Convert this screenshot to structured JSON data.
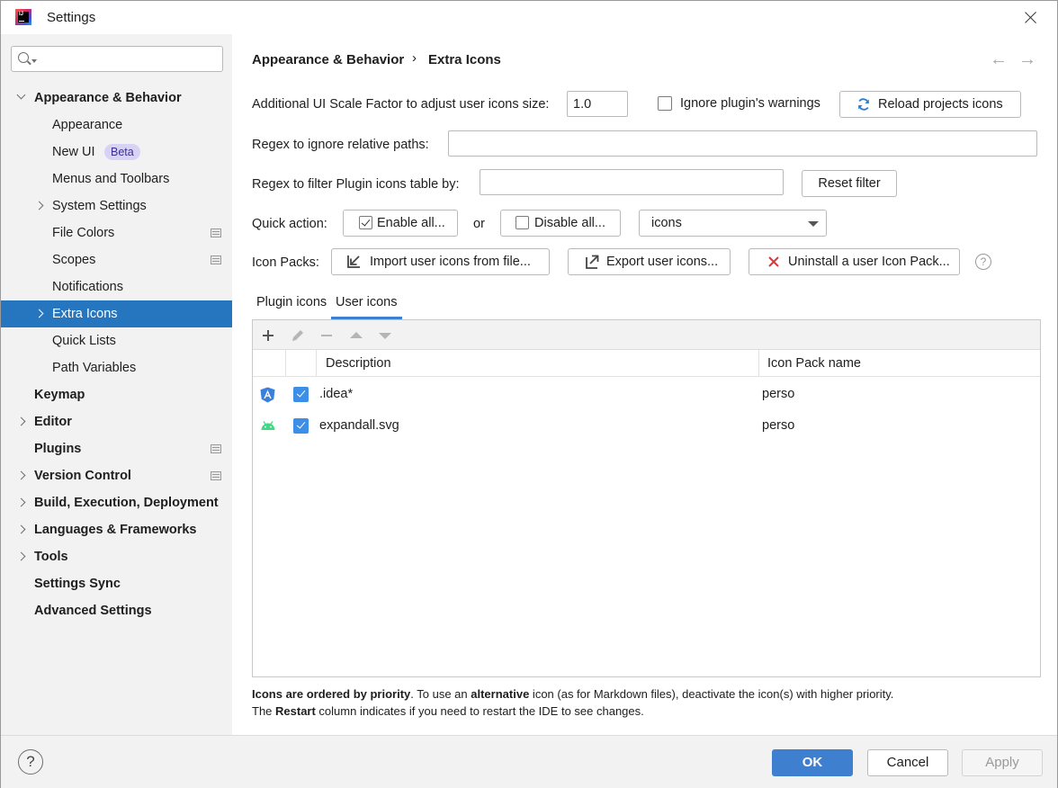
{
  "window": {
    "title": "Settings"
  },
  "sidebar": {
    "search": {
      "value": "",
      "placeholder": ""
    },
    "items": [
      {
        "label": "Appearance & Behavior",
        "bold": true,
        "chevron": "down",
        "indent": 0
      },
      {
        "label": "Appearance",
        "indent": 1
      },
      {
        "label": "New UI",
        "indent": 1,
        "badge": "Beta"
      },
      {
        "label": "Menus and Toolbars",
        "indent": 1
      },
      {
        "label": "System Settings",
        "indent": 1,
        "chevron": "right"
      },
      {
        "label": "File Colors",
        "indent": 1,
        "scope": true
      },
      {
        "label": "Scopes",
        "indent": 1,
        "scope": true
      },
      {
        "label": "Notifications",
        "indent": 1
      },
      {
        "label": "Extra Icons",
        "indent": 1,
        "chevron": "right",
        "selected": true
      },
      {
        "label": "Quick Lists",
        "indent": 1
      },
      {
        "label": "Path Variables",
        "indent": 1
      },
      {
        "label": "Keymap",
        "bold": true,
        "indent": 0
      },
      {
        "label": "Editor",
        "bold": true,
        "chevron": "right",
        "indent": 0
      },
      {
        "label": "Plugins",
        "bold": true,
        "indent": 0,
        "scope": true
      },
      {
        "label": "Version Control",
        "bold": true,
        "chevron": "right",
        "indent": 0,
        "scope": true
      },
      {
        "label": "Build, Execution, Deployment",
        "bold": true,
        "chevron": "right",
        "indent": 0
      },
      {
        "label": "Languages & Frameworks",
        "bold": true,
        "chevron": "right",
        "indent": 0
      },
      {
        "label": "Tools",
        "bold": true,
        "chevron": "right",
        "indent": 0
      },
      {
        "label": "Settings Sync",
        "bold": true,
        "indent": 0
      },
      {
        "label": "Advanced Settings",
        "bold": true,
        "indent": 0
      }
    ]
  },
  "breadcrumb": {
    "parent": "Appearance & Behavior",
    "separator": "›",
    "current": "Extra Icons",
    "back": "←",
    "forward": "→"
  },
  "form": {
    "scale_label": "Additional UI Scale Factor to adjust user icons size:",
    "scale_value": "1.0",
    "ignore_warnings_label": "Ignore plugin's warnings",
    "ignore_warnings_checked": false,
    "reload_label": "Reload projects icons",
    "regex_ignore_label": "Regex to ignore relative paths:",
    "regex_ignore_value": "",
    "regex_filter_label": "Regex to filter Plugin icons table by:",
    "regex_filter_value": "",
    "reset_filter_label": "Reset filter",
    "quick_action_label": "Quick action:",
    "enable_all_label": "Enable all...",
    "or_label": "or",
    "disable_all_label": "Disable all...",
    "quick_action_select": "icons",
    "icon_packs_label": "Icon Packs:",
    "import_label": "Import user icons from file...",
    "export_label": "Export user icons...",
    "uninstall_label": "Uninstall a user Icon Pack...",
    "help": "?"
  },
  "tabs": [
    {
      "label": "Plugin icons",
      "active": false
    },
    {
      "label": "User icons",
      "active": true
    }
  ],
  "table": {
    "columns": [
      "Description",
      "Icon Pack name"
    ],
    "rows": [
      {
        "icon": "angular-icon",
        "checked": true,
        "description": ".idea*",
        "pack": "perso"
      },
      {
        "icon": "android-icon",
        "checked": true,
        "description": "expandall.svg",
        "pack": "perso"
      }
    ]
  },
  "notes": {
    "line1_bold1": "Icons are ordered by priority",
    "line1_text1": ". To use an ",
    "line1_bold2": "alternative",
    "line1_text2": " icon (as for Markdown files), deactivate the icon(s) with higher priority.",
    "line2_text1": "The ",
    "line2_bold": "Restart",
    "line2_text2": " column indicates if you need to restart the IDE to see changes."
  },
  "footer": {
    "help": "?",
    "ok": "OK",
    "cancel": "Cancel",
    "apply": "Apply"
  },
  "colors": {
    "accent": "#3e7fd0",
    "selection": "#2675bf",
    "sidebar_bg": "#f2f2f2",
    "badge_bg": "#d8d2f5"
  }
}
